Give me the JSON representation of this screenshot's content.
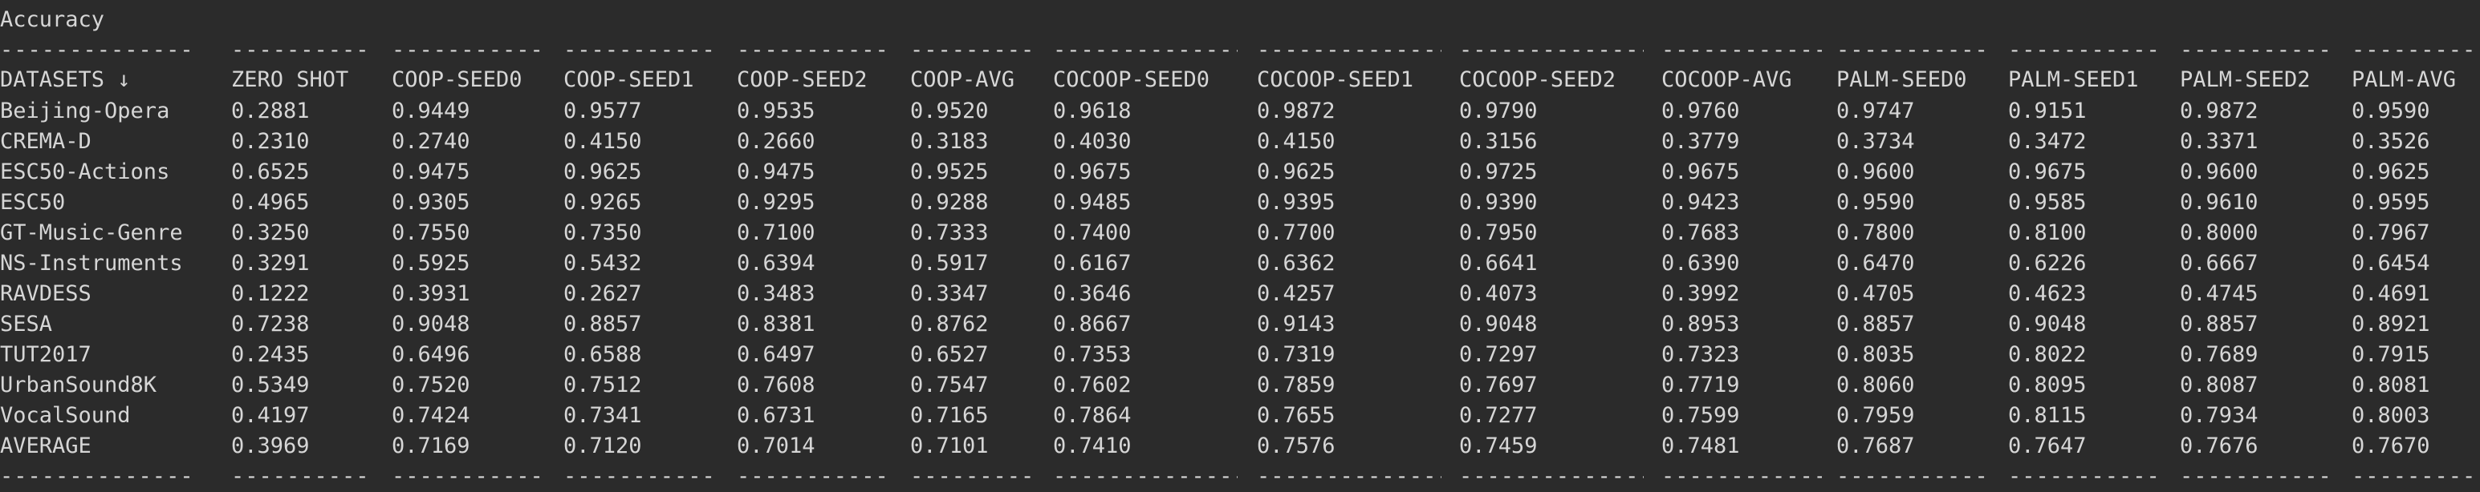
{
  "title": "Accuracy",
  "separator": "--------------",
  "headers": [
    "DATASETS ↓",
    "ZERO SHOT",
    "COOP-SEED0",
    "COOP-SEED1",
    "COOP-SEED2",
    "COOP-AVG",
    "COCOOP-SEED0",
    "COCOOP-SEED1",
    "COCOOP-SEED2",
    "COCOOP-AVG",
    "PALM-SEED0",
    "PALM-SEED1",
    "PALM-SEED2",
    "PALM-AVG"
  ],
  "rows": [
    [
      "Beijing-Opera",
      "0.2881",
      "0.9449",
      "0.9577",
      "0.9535",
      "0.9520",
      "0.9618",
      "0.9872",
      "0.9790",
      "0.9760",
      "0.9747",
      "0.9151",
      "0.9872",
      "0.9590"
    ],
    [
      "CREMA-D",
      "0.2310",
      "0.2740",
      "0.4150",
      "0.2660",
      "0.3183",
      "0.4030",
      "0.4150",
      "0.3156",
      "0.3779",
      "0.3734",
      "0.3472",
      "0.3371",
      "0.3526"
    ],
    [
      "ESC50-Actions",
      "0.6525",
      "0.9475",
      "0.9625",
      "0.9475",
      "0.9525",
      "0.9675",
      "0.9625",
      "0.9725",
      "0.9675",
      "0.9600",
      "0.9675",
      "0.9600",
      "0.9625"
    ],
    [
      "ESC50",
      "0.4965",
      "0.9305",
      "0.9265",
      "0.9295",
      "0.9288",
      "0.9485",
      "0.9395",
      "0.9390",
      "0.9423",
      "0.9590",
      "0.9585",
      "0.9610",
      "0.9595"
    ],
    [
      "GT-Music-Genre",
      "0.3250",
      "0.7550",
      "0.7350",
      "0.7100",
      "0.7333",
      "0.7400",
      "0.7700",
      "0.7950",
      "0.7683",
      "0.7800",
      "0.8100",
      "0.8000",
      "0.7967"
    ],
    [
      "NS-Instruments",
      "0.3291",
      "0.5925",
      "0.5432",
      "0.6394",
      "0.5917",
      "0.6167",
      "0.6362",
      "0.6641",
      "0.6390",
      "0.6470",
      "0.6226",
      "0.6667",
      "0.6454"
    ],
    [
      "RAVDESS",
      "0.1222",
      "0.3931",
      "0.2627",
      "0.3483",
      "0.3347",
      "0.3646",
      "0.4257",
      "0.4073",
      "0.3992",
      "0.4705",
      "0.4623",
      "0.4745",
      "0.4691"
    ],
    [
      "SESA",
      "0.7238",
      "0.9048",
      "0.8857",
      "0.8381",
      "0.8762",
      "0.8667",
      "0.9143",
      "0.9048",
      "0.8953",
      "0.8857",
      "0.9048",
      "0.8857",
      "0.8921"
    ],
    [
      "TUT2017",
      "0.2435",
      "0.6496",
      "0.6588",
      "0.6497",
      "0.6527",
      "0.7353",
      "0.7319",
      "0.7297",
      "0.7323",
      "0.8035",
      "0.8022",
      "0.7689",
      "0.7915"
    ],
    [
      "UrbanSound8K",
      "0.5349",
      "0.7520",
      "0.7512",
      "0.7608",
      "0.7547",
      "0.7602",
      "0.7859",
      "0.7697",
      "0.7719",
      "0.8060",
      "0.8095",
      "0.8087",
      "0.8081"
    ],
    [
      "VocalSound",
      "0.4197",
      "0.7424",
      "0.7341",
      "0.6731",
      "0.7165",
      "0.7864",
      "0.7655",
      "0.7277",
      "0.7599",
      "0.7959",
      "0.8115",
      "0.7934",
      "0.8003"
    ],
    [
      "AVERAGE",
      "0.3969",
      "0.7169",
      "0.7120",
      "0.7014",
      "0.7101",
      "0.7410",
      "0.7576",
      "0.7459",
      "0.7481",
      "0.7687",
      "0.7647",
      "0.7676",
      "0.7670"
    ]
  ]
}
